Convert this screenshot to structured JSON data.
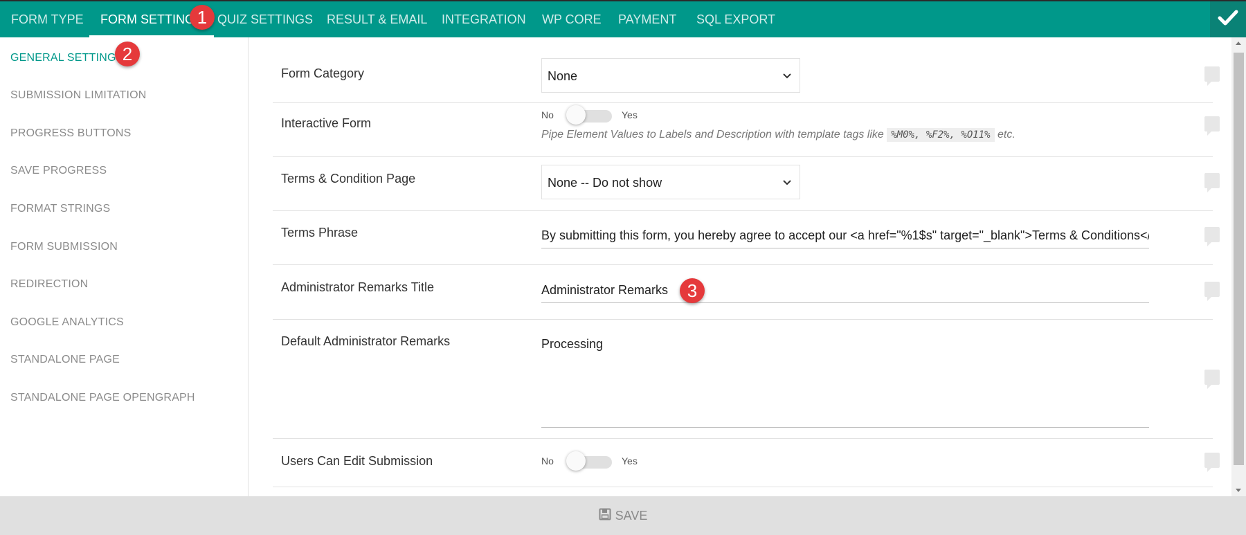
{
  "tabs": [
    {
      "label": "FORM TYPE"
    },
    {
      "label": "FORM SETTINGS"
    },
    {
      "label": "QUIZ SETTINGS"
    },
    {
      "label": "RESULT & EMAIL"
    },
    {
      "label": "INTEGRATION"
    },
    {
      "label": "WP CORE"
    },
    {
      "label": "PAYMENT"
    },
    {
      "label": "SQL EXPORT"
    }
  ],
  "active_tab": "FORM SETTINGS",
  "sidebar": {
    "items": [
      {
        "label": "GENERAL SETTINGS"
      },
      {
        "label": "SUBMISSION LIMITATION"
      },
      {
        "label": "PROGRESS BUTTONS"
      },
      {
        "label": "SAVE PROGRESS"
      },
      {
        "label": "FORMAT STRINGS"
      },
      {
        "label": "FORM SUBMISSION"
      },
      {
        "label": "REDIRECTION"
      },
      {
        "label": "GOOGLE ANALYTICS"
      },
      {
        "label": "STANDALONE PAGE"
      },
      {
        "label": "STANDALONE PAGE OPENGRAPH"
      }
    ],
    "active": "GENERAL SETTINGS"
  },
  "badges": [
    "1",
    "2",
    "3"
  ],
  "settings": {
    "form_category": {
      "label": "Form Category",
      "value": "None"
    },
    "interactive_form": {
      "label": "Interactive Form",
      "no": "No",
      "yes": "Yes",
      "on": false,
      "desc_prefix": "Pipe Element Values to Labels and Description with template tags like",
      "desc_code": "%M0%, %F2%, %O11%",
      "desc_suffix": "etc."
    },
    "terms_page": {
      "label": "Terms & Condition Page",
      "value": "None -- Do not show"
    },
    "terms_phrase": {
      "label": "Terms Phrase",
      "value": "By submitting this form, you hereby agree to accept our <a href=\"%1$s\" target=\"_blank\">Terms & Conditions</a>. Y"
    },
    "admin_remarks_title": {
      "label": "Administrator Remarks Title",
      "value": "Administrator Remarks"
    },
    "default_admin_remarks": {
      "label": "Default Administrator Remarks",
      "value": "Processing"
    },
    "users_can_edit": {
      "label": "Users Can Edit Submission",
      "no": "No",
      "yes": "Yes",
      "on": false
    }
  },
  "footer": {
    "save_label": "SAVE"
  },
  "colors": {
    "accent": "#00988a",
    "badge": "#e5393b"
  },
  "icons": {
    "confirm": "checkmark-icon",
    "save": "floppy-disk-icon",
    "help": "help-icon",
    "dropdown": "chevron-down-icon"
  }
}
